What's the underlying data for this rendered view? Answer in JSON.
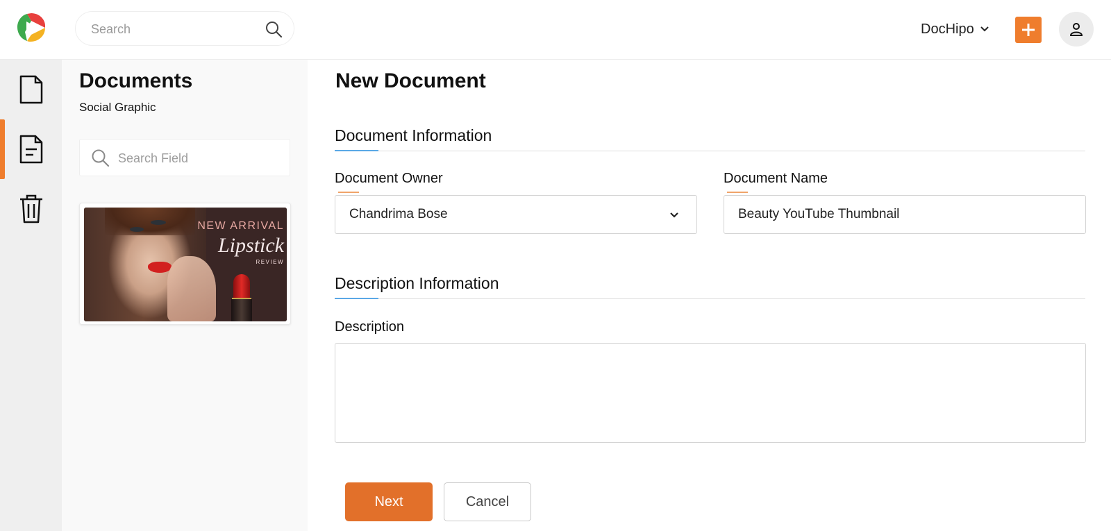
{
  "header": {
    "search_placeholder": "Search",
    "brand_label": "DocHipo",
    "accent_color": "#ef7d2d"
  },
  "rail": {
    "items": [
      {
        "icon": "document-icon"
      },
      {
        "icon": "document-lines-icon",
        "active": true
      },
      {
        "icon": "trash-icon"
      }
    ]
  },
  "panel": {
    "title": "Documents",
    "subtitle": "Social Graphic",
    "search_placeholder": "Search Field",
    "thumbnail": {
      "headline": "NEW ARRIVAL",
      "title": "Lipstick",
      "tag": "REVIEW"
    }
  },
  "main": {
    "title": "New Document",
    "doc_info": {
      "title": "Document Information",
      "owner_label": "Document Owner",
      "owner_value": "Chandrima Bose",
      "name_label": "Document Name",
      "name_value": "Beauty YouTube Thumbnail"
    },
    "desc_info": {
      "title": "Description Information",
      "desc_label": "Description",
      "desc_value": ""
    },
    "buttons": {
      "next": "Next",
      "cancel": "Cancel"
    }
  }
}
